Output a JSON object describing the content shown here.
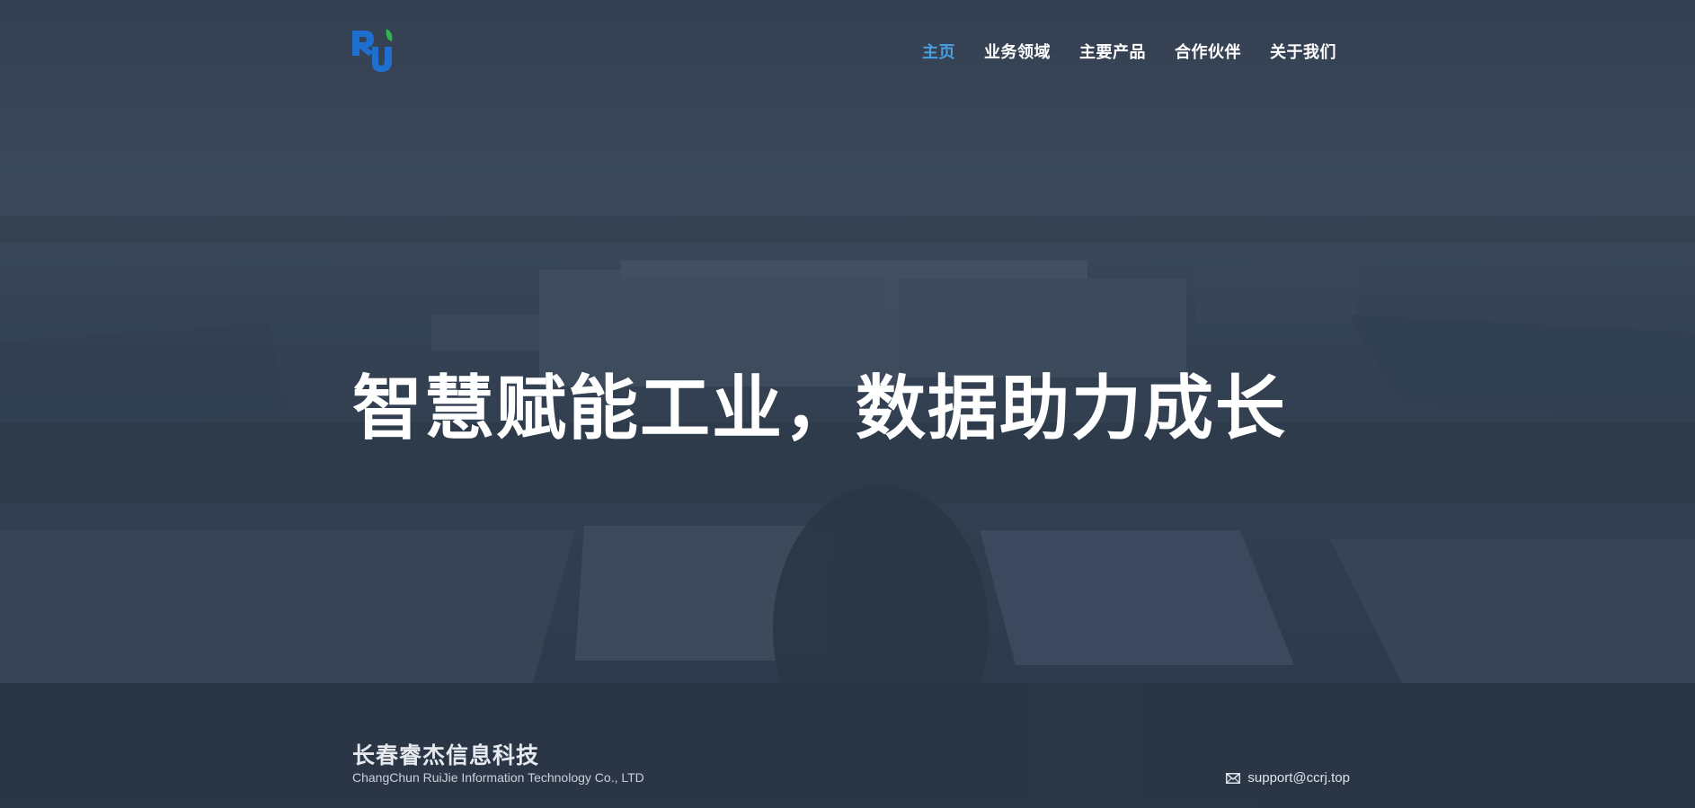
{
  "nav": {
    "items": [
      {
        "label": "主页",
        "active": true
      },
      {
        "label": "业务领域",
        "active": false
      },
      {
        "label": "主要产品",
        "active": false
      },
      {
        "label": "合作伙伴",
        "active": false
      },
      {
        "label": "关于我们",
        "active": false
      }
    ]
  },
  "hero": {
    "headline": "智慧赋能工业，数据助力成长"
  },
  "footer": {
    "company_cn": "长春睿杰信息科技",
    "company_en": "ChangChun RuiJie Information Technology Co., LTD",
    "email": "support@ccrj.top",
    "email_icon": "mail-icon"
  },
  "colors": {
    "accent": "#4a9fe0",
    "logo_blue": "#1f6fd1",
    "logo_green": "#2fb34a",
    "overlay": "#3d4b5e"
  },
  "background_icon": "industrial-park-aerial-photo"
}
